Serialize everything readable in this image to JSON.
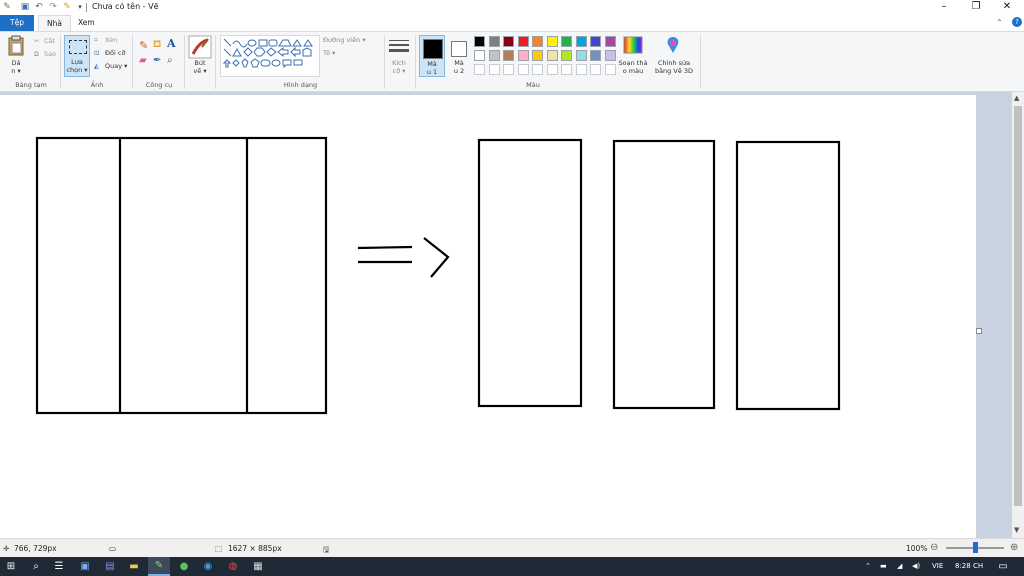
{
  "app": {
    "title": "Chưa có tên - Vẽ",
    "help": "?"
  },
  "tabs": [
    {
      "label": "Tệp"
    },
    {
      "label": "Nhà"
    },
    {
      "label": "Xem"
    }
  ],
  "ribbon": {
    "clipboard": {
      "paste_label_1": "Dá",
      "paste_label_2": "n ▾",
      "cut": "Cắt",
      "copy": "Sao",
      "group": "Bảng tạm"
    },
    "image": {
      "select_label_1": "Lựa",
      "select_label_2": "chọn ▾",
      "crop": "Xén",
      "resize": "Đổi cỡ",
      "rotate": "Quay ▾",
      "group": "Ảnh"
    },
    "tools": {
      "text_icon": "A",
      "group": "Công cụ"
    },
    "brushes": {
      "label_1": "Bút",
      "label_2": "vẽ ▾"
    },
    "shapes": {
      "outline": "Đường viền ▾",
      "fill": "Tô ▾",
      "group": "Hình dạng"
    },
    "size": {
      "label_1": "Kích",
      "label_2": "cỡ ▾"
    },
    "colors": {
      "color1_label_1": "Mà",
      "color1_label_2": "u 1",
      "color2_label_1": "Mà",
      "color2_label_2": "u 2",
      "edit_colors_1": "Soạn thả",
      "edit_colors_2": "o màu",
      "paint3d_1": "Chỉnh sửa",
      "paint3d_2": "bằng Vẽ 3D",
      "group": "Màu",
      "color1": "#000000",
      "color2": "#ffffff",
      "palette_row1": [
        "#000000",
        "#7f7f7f",
        "#880015",
        "#ed1c24",
        "#ff7f27",
        "#fff200",
        "#22b14c",
        "#00a2e8",
        "#3f48cc",
        "#a349a4"
      ],
      "palette_row2": [
        "#ffffff",
        "#c3c3c3",
        "#b97a57",
        "#ffaec9",
        "#ffc90e",
        "#efe4b0",
        "#b5e61d",
        "#99d9ea",
        "#7092be",
        "#c8bfe7"
      ]
    }
  },
  "status": {
    "cursor_pos": "766, 729px",
    "canvas_size": "1627 × 885px",
    "zoom": "100%",
    "zoom_level": 0.5
  },
  "taskbar": {
    "lang": "VIE",
    "time": "8:28 CH"
  }
}
